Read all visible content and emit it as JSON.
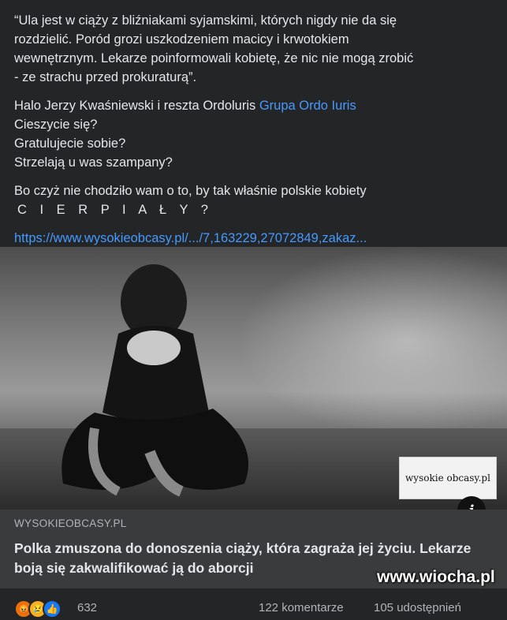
{
  "post": {
    "quote_lines": [
      "“Ula jest w ciąży z bliźniakami syjamskimi, których nigdy nie da się",
      "rozdzielić. Poród grozi uszkodzeniem macicy i krwotokiem",
      "wewnętrznym. Lekarze poinformowali kobietę, że nic nie mogą zrobić",
      "- ze strachu przed prokuraturą”."
    ],
    "halo_text": "Halo Jerzy Kwaśniewski i reszta Ordoluris ",
    "mention": "Grupa Ordo Iuris",
    "questions": [
      "Cieszycie się?",
      "Gratulujecie sobie?",
      "Strzelają u was szampany?"
    ],
    "closing_line": "Bo czyż nie chodziło wam o to, by tak właśnie polskie kobiety",
    "closing_spaced": "C I E R P I A Ł Y ?",
    "link": "https://www.wysokieobcasy.pl/.../7,163229,27072849,zakaz..."
  },
  "photo": {
    "watermark": "wysokie obcasy.pl",
    "info_icon": "info-icon"
  },
  "card": {
    "domain": "WYSOKIEOBCASY.PL",
    "headline": "Polka zmuszona do donoszenia ciąży, która zagraża jej życiu. Lekarze boją się zakwalifikować ją do aborcji"
  },
  "footer": {
    "reactions": [
      "angry-icon",
      "sad-icon",
      "like-icon"
    ],
    "reaction_count": "632",
    "comments": "122 komentarze",
    "shares": "105 udostępnień"
  },
  "overlay": {
    "site_watermark": "www.wiocha.pl"
  }
}
